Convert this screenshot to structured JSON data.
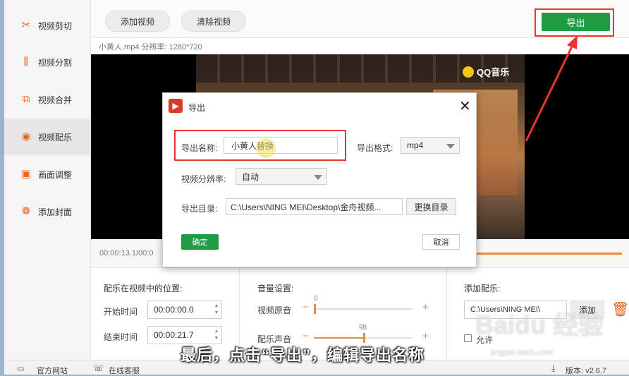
{
  "sidebar": {
    "items": [
      {
        "label": "视频剪切",
        "icon": "scissors-icon",
        "glyph": "✂"
      },
      {
        "label": "视频分割",
        "icon": "split-icon",
        "glyph": "⫼"
      },
      {
        "label": "视频合并",
        "icon": "merge-icon",
        "glyph": "⧉"
      },
      {
        "label": "视频配乐",
        "icon": "music-disc-icon",
        "glyph": "◉"
      },
      {
        "label": "画面调整",
        "icon": "image-adjust-icon",
        "glyph": "▣"
      },
      {
        "label": "添加封面",
        "icon": "cover-icon",
        "glyph": "❁"
      }
    ]
  },
  "toolbar": {
    "add_video": "添加视频",
    "clear_video": "清除视频",
    "export": "导出"
  },
  "file_info": "小黄人.mp4   分辨率: 1280*720",
  "player": {
    "watermark_logo": "QQ音乐",
    "time": "00:00:13.1/00:0"
  },
  "bottom": {
    "position": {
      "title": "配乐在视频中的位置:",
      "start_label": "开始时间",
      "start_value": "00:00:00.0",
      "end_label": "结束时间",
      "end_value": "00:00:21.7"
    },
    "volume": {
      "title": "音量设置:",
      "original_label": "视频原音",
      "original_value": "0",
      "music_label": "配乐声音",
      "music_value": "98",
      "minus": "−",
      "plus": "+"
    },
    "add_music": {
      "title": "添加配乐:",
      "path": "C:\\Users\\NING MEI\\",
      "add_button": "添加",
      "loop_label": "允许"
    }
  },
  "statusbar": {
    "website": "官方网站",
    "support": "在线客服",
    "version": "版本: v2.6.7"
  },
  "dialog": {
    "title": "导出",
    "name_label": "导出名称:",
    "name_value": "小黄人替换",
    "format_label": "导出格式:",
    "format_value": "mp4",
    "resolution_label": "视频分辨率:",
    "resolution_value": "自动",
    "dir_label": "导出目录:",
    "dir_value": "C:\\Users\\NING MEI\\Desktop\\金舟视频...",
    "change_dir": "更换目录",
    "ok": "确定",
    "cancel": "取消"
  },
  "caption": "最后，点击“导出”，编辑导出名称",
  "baidu_watermark": "Baidu 经验",
  "baidu_url": "jingyan.baidu.com",
  "colors": {
    "accent_green": "#1f9b44",
    "accent_orange": "#f08a3c",
    "highlight_red": "#ee3333"
  }
}
